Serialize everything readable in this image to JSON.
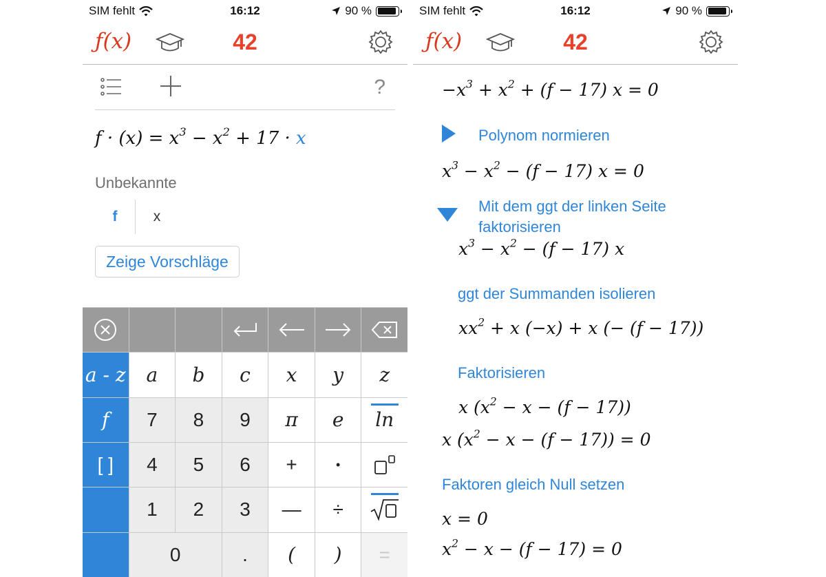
{
  "status": {
    "carrier": "SIM fehlt",
    "time": "16:12",
    "battery": "90 %",
    "battery_level": 0.9
  },
  "nav": {
    "fx_label": "f(x)",
    "score": "42"
  },
  "left": {
    "help": "?",
    "equation": {
      "lhs": "f · (x) = x",
      "e1": "3",
      "m1": " − x",
      "e2": "2",
      "m2": " + 17 · ",
      "var": "x"
    },
    "unknowns_label": "Unbekannte",
    "unknowns": [
      "f",
      "x"
    ],
    "suggest_button": "Zeige Vorschläge"
  },
  "keyboard": {
    "rows": [
      [
        "⊗",
        "",
        "",
        "↵",
        "←",
        "→",
        "⌫"
      ],
      [
        "a - z",
        "a",
        "b",
        "c",
        "x",
        "y",
        "z"
      ],
      [
        "f",
        "7",
        "8",
        "9",
        "π",
        "e",
        "ln"
      ],
      [
        "[ ]",
        "4",
        "5",
        "6",
        "+",
        "•",
        "□□"
      ],
      [
        "",
        "1",
        "2",
        "3",
        "—",
        "÷",
        "√□"
      ],
      [
        "",
        "0",
        ".",
        "(",
        ")",
        "="
      ]
    ]
  },
  "right": {
    "eq0": {
      "a": "−x",
      "e1": "3",
      "b": " + x",
      "e2": "2",
      "c": " + (f − 17) x = 0"
    },
    "step1": "Polynom normieren",
    "eq1": {
      "a": "x",
      "e1": "3",
      "b": " − x",
      "e2": "2",
      "c": " − (f − 17) x = 0"
    },
    "step2_line1": "Mit dem ggt der linken Seite",
    "step2_line2": "faktorisieren",
    "eq2": {
      "a": "x",
      "e1": "3",
      "b": " − x",
      "e2": "2",
      "c": " − (f − 17) x"
    },
    "step3": "ggt der Summanden isolieren",
    "eq3": {
      "a": "xx",
      "e1": "2",
      "b": " + x (−x) + x (− (f − 17))"
    },
    "step4": "Faktorisieren",
    "eq4": {
      "a": "x (x",
      "e1": "2",
      "b": " − x − (f − 17))"
    },
    "eq5": {
      "a": "x (x",
      "e1": "2",
      "b": " − x − (f − 17)) = 0"
    },
    "step5": "Faktoren gleich Null setzen",
    "eq6": "x = 0",
    "eq7": {
      "a": "x",
      "e1": "2",
      "b": " − x − (f − 17) = 0"
    }
  }
}
